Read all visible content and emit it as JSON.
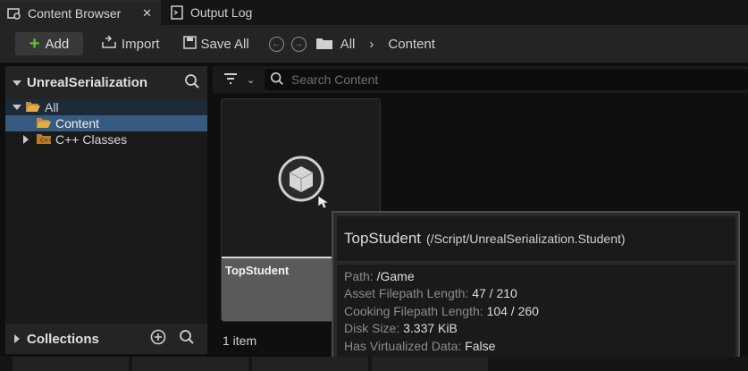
{
  "tabs": [
    {
      "label": "Content Browser",
      "active": true,
      "icon": "content-browser-icon",
      "closable": true
    },
    {
      "label": "Output Log",
      "active": false,
      "icon": "output-log-icon"
    }
  ],
  "toolbar": {
    "add_label": "Add",
    "import_label": "Import",
    "save_all_label": "Save All",
    "breadcrumbs": [
      "All",
      "Content"
    ]
  },
  "sources": {
    "root_label": "UnrealSerialization",
    "tree": [
      {
        "label": "All",
        "expanded": true
      },
      {
        "label": "Content",
        "selected": true
      },
      {
        "label": "C++ Classes",
        "expanded": false
      }
    ]
  },
  "collections": {
    "label": "Collections"
  },
  "search": {
    "placeholder": "Search Content"
  },
  "assets": [
    {
      "name": "TopStudent"
    }
  ],
  "item_count": "1 item",
  "tooltip": {
    "name": "TopStudent",
    "class_path": "(/Script/UnrealSerialization.Student)",
    "rows": [
      {
        "key": "Path:",
        "value": "/Game"
      },
      {
        "key": "Asset Filepath Length:",
        "value": "47 / 210"
      },
      {
        "key": "Cooking Filepath Length:",
        "value": "104 / 260"
      },
      {
        "key": "Disk Size:",
        "value": "3.337 KiB"
      },
      {
        "key": "Has Virtualized Data:",
        "value": "False"
      }
    ]
  },
  "colors": {
    "accent_add": "#5fbf3f",
    "selection": "#375a80",
    "folder": "#d9a441"
  }
}
